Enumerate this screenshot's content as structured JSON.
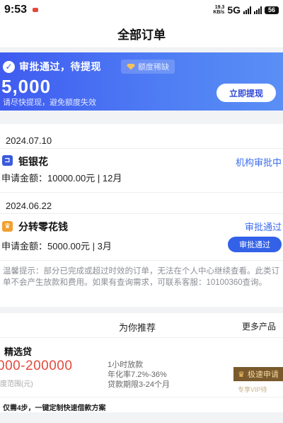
{
  "status_bar": {
    "time": "9:53",
    "net_speed_value": "19.3",
    "net_speed_unit": "KB/s",
    "network": "5G",
    "battery": "56"
  },
  "nav": {
    "title": "全部订单"
  },
  "hero": {
    "status": "审批通过，待提现",
    "quota_tag": "额度稀缺",
    "amount": "5,000",
    "subtitle": "请尽快提现，避免额度失效",
    "withdraw_button": "立即提现"
  },
  "orders": [
    {
      "date": "2024.07.10",
      "lender": "钜银花",
      "status": "机构审批中",
      "apply_label": "申请金额：10000.00元",
      "term": "12月",
      "icon_color": "#3b5bdb"
    },
    {
      "date": "2024.06.22",
      "lender": "分转零花钱",
      "status": "审批通过",
      "apply_label": "申请金额：5000.00元",
      "term": "3月",
      "button": "审批通过",
      "icon_color": "#f0a030"
    }
  ],
  "tip": "温馨提示：部分已完成或超过时效的订单，无法在个人中心继续查看。此类订单不会产生放款和费用。如果有查询需求，可联系客服：10100360查询。",
  "recommend": {
    "title": "为你推荐",
    "more": "更多产品",
    "product": {
      "name": "精选贷",
      "range": "000-200000",
      "range_label": "度范围(元)",
      "features": [
        "1小时放款",
        "年化率7.2%-36%",
        "贷款期限3-24个月"
      ],
      "apply_button": "极速申请",
      "vip_text": "专享VIP待"
    },
    "bottom_note": "仅需4步，一键定制快速借款方案"
  },
  "colors": {
    "accent": "#3361e8",
    "hero_start": "#3f5bf0",
    "hero_end": "#5a8ff5",
    "range_red": "#e44a3c"
  }
}
